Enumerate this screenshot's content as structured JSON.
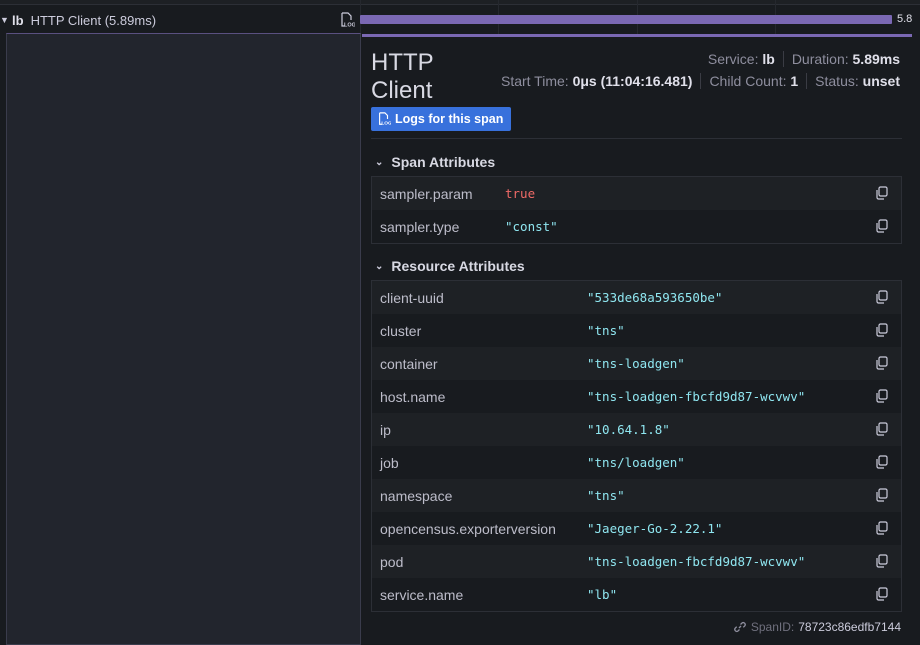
{
  "span_row": {
    "service": "lb",
    "operation": "HTTP Client (5.89ms)",
    "bar_label": "5.8"
  },
  "detail": {
    "title": "HTTP Client",
    "service_label": "Service:",
    "service_value": "lb",
    "duration_label": "Duration:",
    "duration_value": "5.89ms",
    "start_label": "Start Time:",
    "start_value": "0μs (11:04:16.481)",
    "child_label": "Child Count:",
    "child_value": "1",
    "status_label": "Status:",
    "status_value": "unset",
    "logs_button": "Logs for this span"
  },
  "span_attributes": {
    "header": "Span Attributes",
    "rows": [
      {
        "key": "sampler.param",
        "value": "true"
      },
      {
        "key": "sampler.type",
        "value": "\"const\""
      }
    ]
  },
  "resource_attributes": {
    "header": "Resource Attributes",
    "rows": [
      {
        "key": "client-uuid",
        "value": "\"533de68a593650be\""
      },
      {
        "key": "cluster",
        "value": "\"tns\""
      },
      {
        "key": "container",
        "value": "\"tns-loadgen\""
      },
      {
        "key": "host.name",
        "value": "\"tns-loadgen-fbcfd9d87-wcvwv\""
      },
      {
        "key": "ip",
        "value": "\"10.64.1.8\""
      },
      {
        "key": "job",
        "value": "\"tns/loadgen\""
      },
      {
        "key": "namespace",
        "value": "\"tns\""
      },
      {
        "key": "opencensus.exporterversion",
        "value": "\"Jaeger-Go-2.22.1\""
      },
      {
        "key": "pod",
        "value": "\"tns-loadgen-fbcfd9d87-wcvwv\""
      },
      {
        "key": "service.name",
        "value": "\"lb\""
      }
    ]
  },
  "footer": {
    "span_id_label": "SpanID:",
    "span_id_value": "78723c86edfb7144"
  },
  "colors": {
    "bar": "#7a68b3",
    "button": "#3871dc",
    "string_value": "#8fe6f0",
    "keyword_value": "#ef6a67"
  },
  "icons": [
    "chevron-down-icon",
    "logs-icon",
    "copy-icon",
    "link-icon"
  ]
}
